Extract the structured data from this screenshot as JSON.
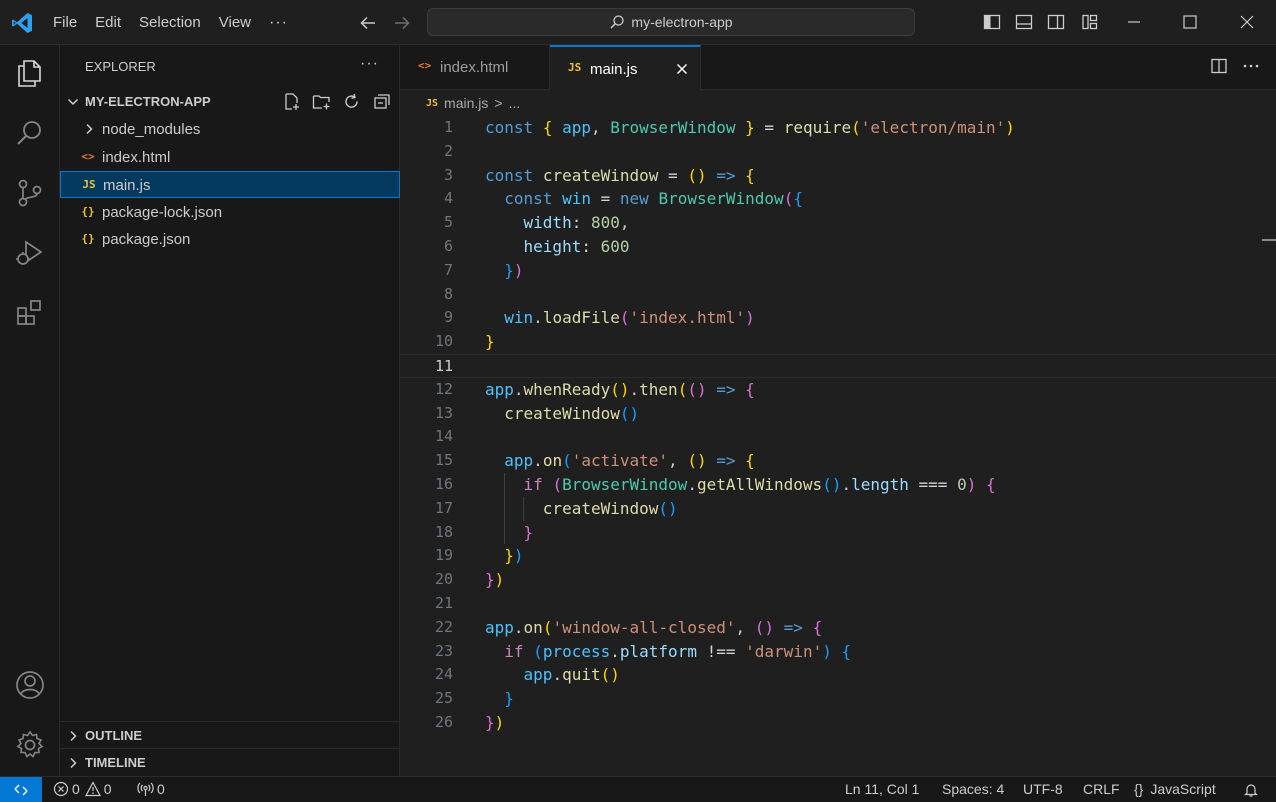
{
  "titlebar": {
    "menu": [
      "File",
      "Edit",
      "Selection",
      "View"
    ],
    "more": "···",
    "search_text": "my-electron-app"
  },
  "explorer": {
    "title": "EXPLORER",
    "more": "···",
    "folder": "MY-ELECTRON-APP",
    "items": [
      {
        "label": "node_modules",
        "icon": "chevron-right-icon"
      },
      {
        "label": "index.html",
        "icon": "<>"
      },
      {
        "label": "main.js",
        "icon": "JS"
      },
      {
        "label": "package-lock.json",
        "icon": "{}"
      },
      {
        "label": "package.json",
        "icon": "{}"
      }
    ],
    "outline": "OUTLINE",
    "timeline": "TIMELINE"
  },
  "tabs": [
    {
      "label": "index.html",
      "icon": "<>"
    },
    {
      "label": "main.js",
      "icon": "JS"
    }
  ],
  "breadcrumb": {
    "file": "main.js",
    "sep": ">",
    "rest": "..."
  },
  "code": {
    "line_numbers": [
      "1",
      "2",
      "3",
      "4",
      "5",
      "6",
      "7",
      "8",
      "9",
      "10",
      "11",
      "12",
      "13",
      "14",
      "15",
      "16",
      "17",
      "18",
      "19",
      "20",
      "21",
      "22",
      "23",
      "24",
      "25",
      "26"
    ],
    "lines": [
      "const { app, BrowserWindow } = require('electron/main')",
      "",
      "const createWindow = () => {",
      "  const win = new BrowserWindow({",
      "    width: 800,",
      "    height: 600",
      "  })",
      "",
      "  win.loadFile('index.html')",
      "}",
      "",
      "app.whenReady().then(() => {",
      "  createWindow()",
      "",
      "  app.on('activate', () => {",
      "    if (BrowserWindow.getAllWindows().length === 0) {",
      "      createWindow()",
      "    }",
      "  })",
      "})",
      "",
      "app.on('window-all-closed', () => {",
      "  if (process.platform !== 'darwin') {",
      "    app.quit()",
      "  }",
      "})"
    ],
    "current_line": 11
  },
  "statusbar": {
    "errors": "0",
    "warnings": "0",
    "ports": "0",
    "position": "Ln 11, Col 1",
    "spaces": "Spaces: 4",
    "encoding": "UTF-8",
    "eol": "CRLF",
    "language_braces": "{}",
    "language": "JavaScript"
  },
  "colors": {
    "accent": "#0078d4",
    "selection": "#04395e"
  }
}
